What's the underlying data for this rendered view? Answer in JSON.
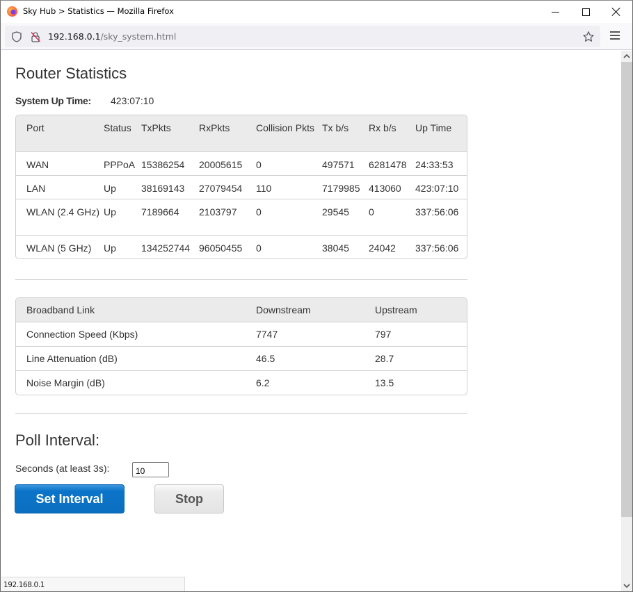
{
  "window": {
    "title": "Sky Hub > Statistics — Mozilla Firefox",
    "controls": {
      "minimize": "minimize",
      "maximize": "maximize",
      "close": "close"
    }
  },
  "navbar": {
    "url_host": "192.168.0.1",
    "url_path": "/sky_system.html",
    "icons": [
      "shield-icon",
      "insecure-lock-icon",
      "bookmark-star-icon",
      "hamburger-menu-icon"
    ]
  },
  "page": {
    "title": "Router Statistics",
    "uptime_label": "System Up Time:",
    "uptime_value": "423:07:10",
    "ports_table": {
      "headers": [
        "Port",
        "Status",
        "TxPkts",
        "RxPkts",
        "Collision Pkts",
        "Tx b/s",
        "Rx b/s",
        "Up Time"
      ],
      "rows": [
        [
          "WAN",
          "PPPoA",
          "15386254",
          "20005615",
          "0",
          "497571",
          "6281478",
          "24:33:53"
        ],
        [
          "LAN",
          "Up",
          "38169143",
          "27079454",
          "110",
          "7179985",
          "413060",
          "423:07:10"
        ],
        [
          "WLAN (2.4 GHz)",
          "Up",
          "7189664",
          "2103797",
          "0",
          "29545",
          "0",
          "337:56:06"
        ],
        [
          "WLAN (5 GHz)",
          "Up",
          "134252744",
          "96050455",
          "0",
          "38045",
          "24042",
          "337:56:06"
        ]
      ]
    },
    "broadband_table": {
      "headers": [
        "Broadband Link",
        "Downstream",
        "Upstream"
      ],
      "rows": [
        [
          "Connection Speed (Kbps)",
          "7747",
          "797"
        ],
        [
          "Line Attenuation (dB)",
          "46.5",
          "28.7"
        ],
        [
          "Noise Margin (dB)",
          "6.2",
          "13.5"
        ]
      ]
    },
    "poll": {
      "title": "Poll Interval:",
      "seconds_label": "Seconds (at least 3s):",
      "seconds_value": "10",
      "set_button": "Set Interval",
      "stop_button": "Stop"
    }
  },
  "statusbar": {
    "text": "192.168.0.1"
  },
  "colors": {
    "primary_button": "#0b6fc0",
    "secondary_button": "#e4e4e4",
    "table_header": "#ebebeb",
    "border": "#cfcfcf"
  }
}
